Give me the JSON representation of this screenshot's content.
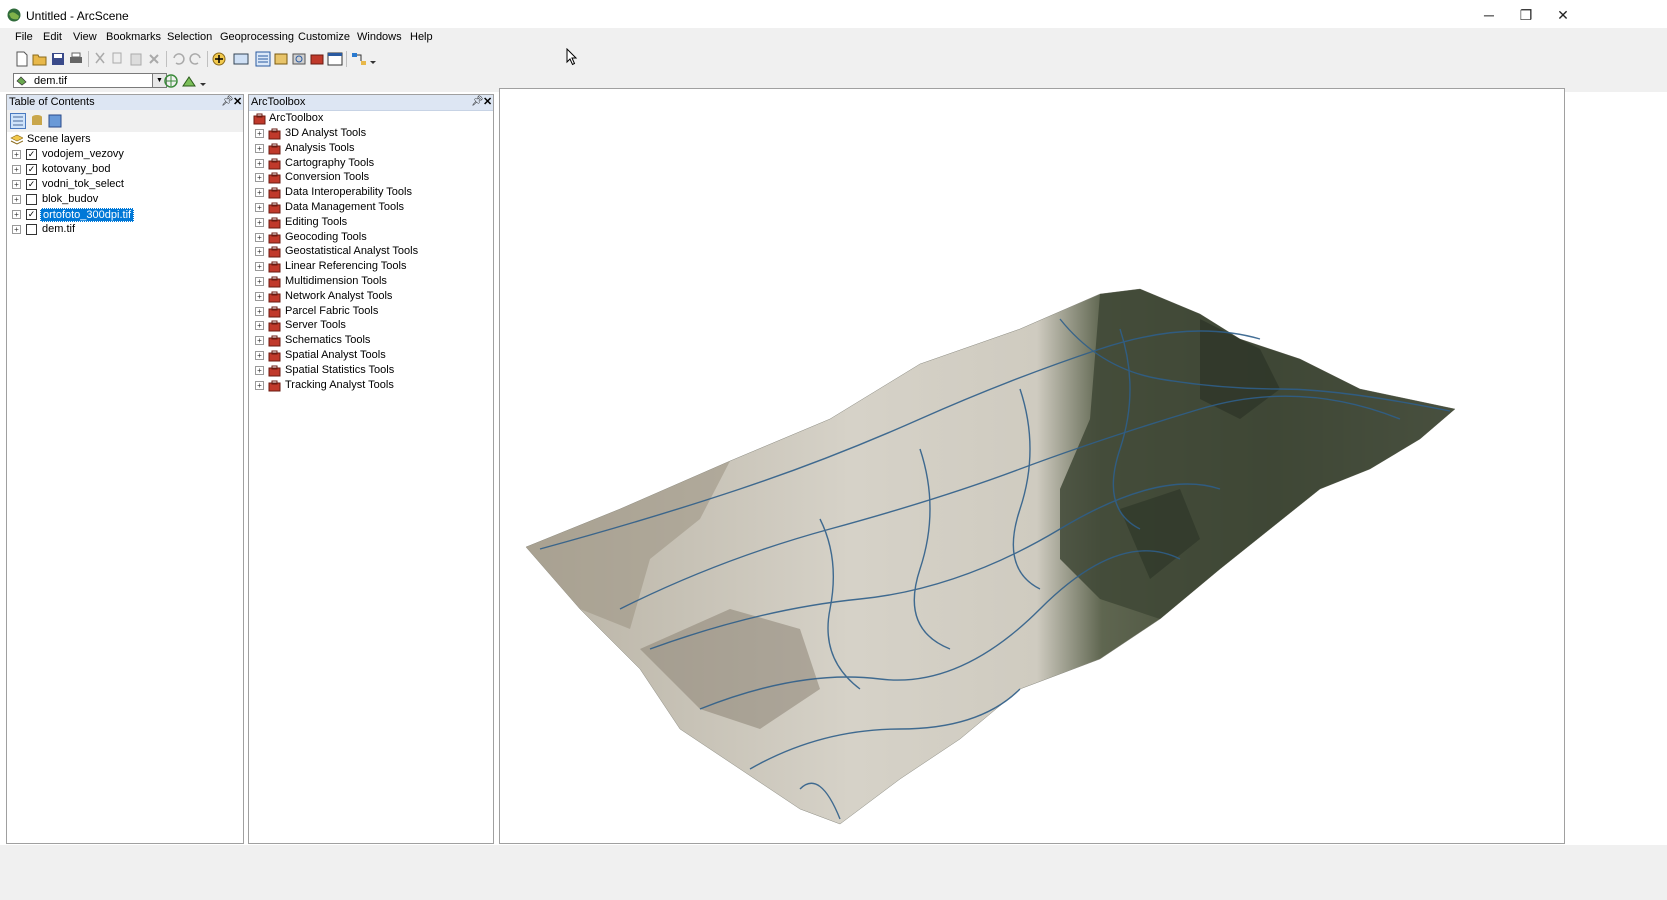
{
  "window": {
    "title": "Untitled - ArcScene",
    "minimize": "─",
    "restore": "❐",
    "close": "✕"
  },
  "menu": [
    "File",
    "Edit",
    "View",
    "Bookmarks",
    "Selection",
    "Geoprocessing",
    "Customize",
    "Windows",
    "Help"
  ],
  "toolbar": {
    "layer_select": "dem.tif"
  },
  "toc": {
    "title": "Table of Contents",
    "root_label": "Scene layers",
    "layers": [
      {
        "name": "vodojem_vezovy",
        "checked": true,
        "selected": false
      },
      {
        "name": "kotovany_bod",
        "checked": true,
        "selected": false
      },
      {
        "name": "vodni_tok_select",
        "checked": true,
        "selected": false
      },
      {
        "name": "blok_budov",
        "checked": false,
        "selected": false
      },
      {
        "name": "ortofoto_300dpi.tif",
        "checked": true,
        "selected": true
      },
      {
        "name": "dem.tif",
        "checked": false,
        "selected": false
      }
    ]
  },
  "toolbox": {
    "title": "ArcToolbox",
    "root_label": "ArcToolbox",
    "items": [
      "3D Analyst Tools",
      "Analysis Tools",
      "Cartography Tools",
      "Conversion Tools",
      "Data Interoperability Tools",
      "Data Management Tools",
      "Editing Tools",
      "Geocoding Tools",
      "Geostatistical Analyst Tools",
      "Linear Referencing Tools",
      "Multidimension Tools",
      "Network Analyst Tools",
      "Parcel Fabric Tools",
      "Server Tools",
      "Schematics Tools",
      "Spatial Analyst Tools",
      "Spatial Statistics Tools",
      "Tracking Analyst Tools"
    ]
  },
  "colors": {
    "selection": "#0078d7",
    "panel_header": "#dde6f3",
    "toolbox_red": "#c0392b"
  }
}
